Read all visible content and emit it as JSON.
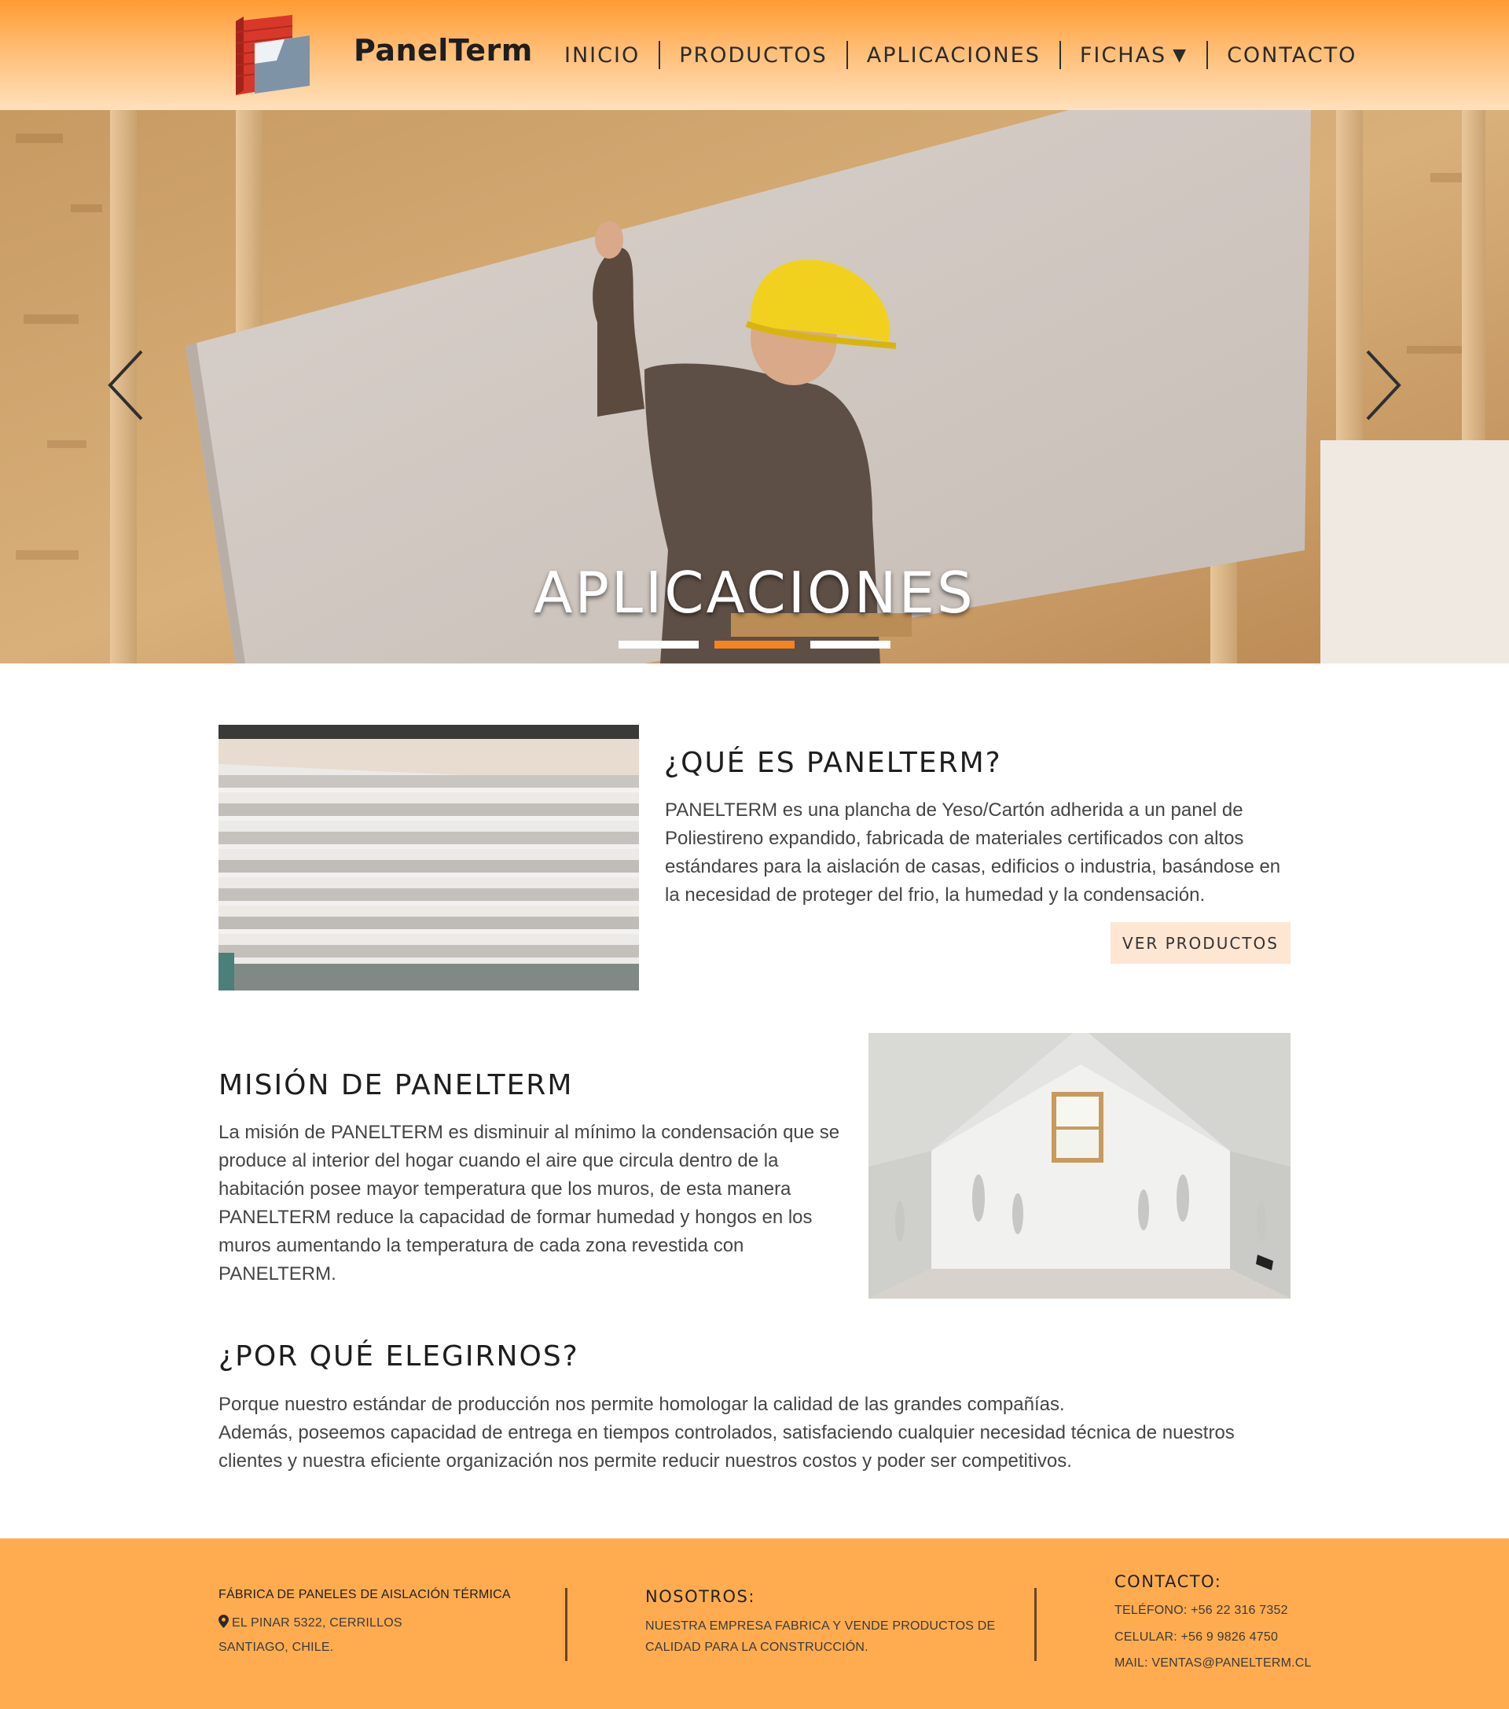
{
  "header": {
    "brand": "PanelTerm",
    "nav": [
      "INICIO",
      "PRODUCTOS",
      "APLICACIONES",
      "FICHAS",
      "CONTACTO"
    ],
    "nav_dropdown_index": 3,
    "accent_color": "#ff9b32"
  },
  "hero": {
    "caption": "APLICACIONES",
    "slides_count": 3,
    "active_slide": 2,
    "indicator_active_color": "#f5841f"
  },
  "about": {
    "title": "¿QUÉ ES PANELTERM?",
    "text": "PANELTERM es una plancha de Yeso/Cartón adherida a un panel de Poliestireno expandido, fabricada de materiales certificados con altos estándares para la aislación de casas, edificios o industria, basándose en la necesidad de proteger del frio, la humedad y la condensación.",
    "button": "VER PRODUCTOS"
  },
  "mission": {
    "title": "MISIÓN DE PANELTERM",
    "text": "La misión de PANELTERM es disminuir al mínimo la condensación que se produce al interior del hogar cuando el aire que circula dentro de la habitación posee mayor temperatura que los muros, de esta manera PANELTERM reduce la capacidad de formar humedad y hongos en los muros  aumentando la temperatura de cada zona revestida con PANELTERM."
  },
  "why": {
    "title": "¿POR QUÉ ELEGIRNOS?",
    "line1": "Porque nuestro estándar de producción nos permite homologar la calidad de las grandes compañías.",
    "line2": "Además, poseemos capacidad de entrega en tiempos controlados, satisfaciendo cualquier necesidad técnica de nuestros clientes y nuestra eficiente organización nos permite reducir nuestros costos y poder ser competitivos."
  },
  "footer": {
    "company": "FÁBRICA DE PANELES DE AISLACIÓN TÉRMICA",
    "address1": "EL PINAR 5322, CERRILLOS",
    "address2": "SANTIAGO, CHILE.",
    "about_title": "NOSOTROS:",
    "about_line1": "NUESTRA EMPRESA FABRICA Y VENDE PRODUCTOS DE",
    "about_line2": "CALIDAD PARA LA CONSTRUCCIÓN.",
    "contact_title": "CONTACTO:",
    "phone": "TELÉFONO: +56 22 316 7352",
    "mobile": "CELULAR: +56 9 9826 4750",
    "mail": "MAIL: VENTAS@PANELTERM.CL",
    "background_color": "#ffac50"
  },
  "icons": {
    "logo": "brick-panel-logo-icon",
    "prev": "chevron-left-icon",
    "next": "chevron-right-icon",
    "dropdown": "caret-down-icon",
    "location": "map-pin-icon"
  }
}
